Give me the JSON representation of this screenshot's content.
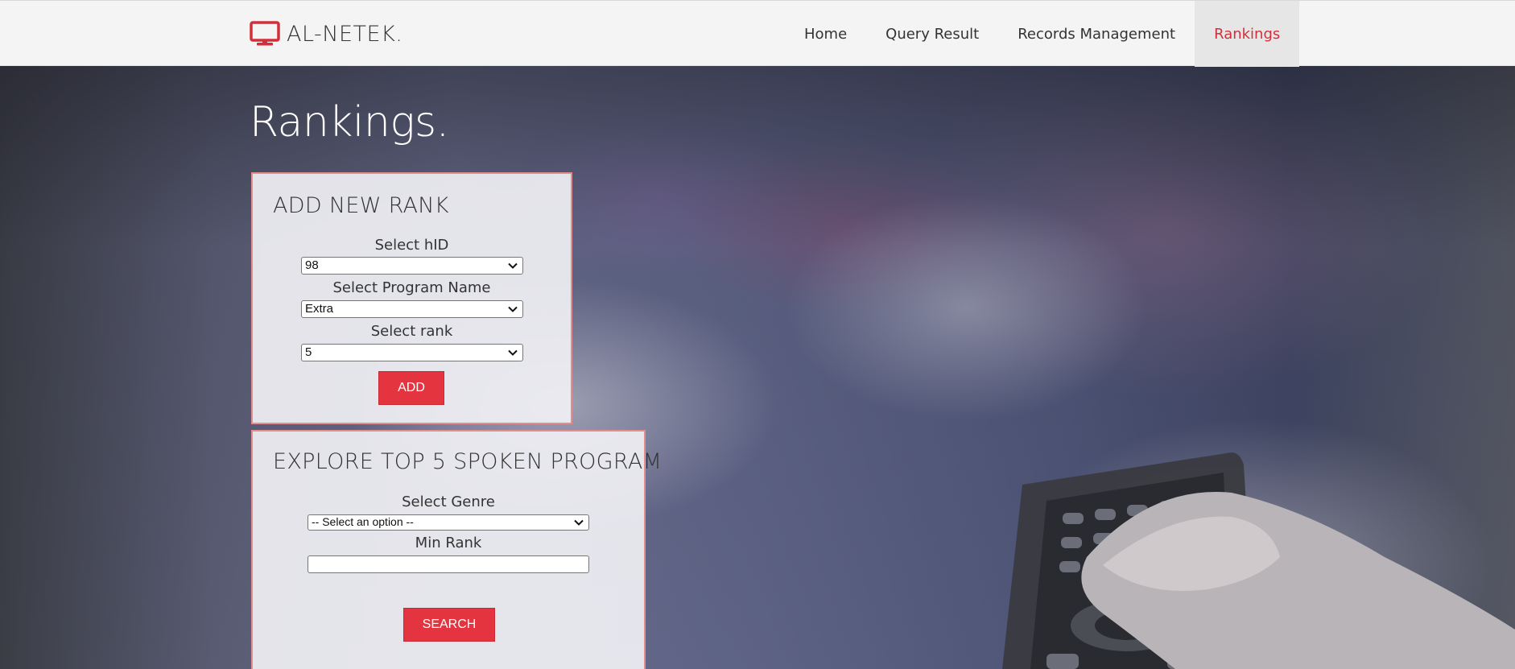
{
  "brand": {
    "name": "AL-NETEK.",
    "icon": "monitor-icon",
    "accent": "#d32f3a"
  },
  "nav": {
    "items": [
      {
        "label": "Home",
        "active": false
      },
      {
        "label": "Query Result",
        "active": false
      },
      {
        "label": "Records Management",
        "active": false
      },
      {
        "label": "Rankings",
        "active": true
      }
    ]
  },
  "page": {
    "title": "Rankings."
  },
  "add_rank": {
    "heading": "ADD NEW RANK",
    "hid": {
      "label": "Select hID",
      "value": "98"
    },
    "program": {
      "label": "Select Program Name",
      "value": "Extra"
    },
    "rank": {
      "label": "Select rank",
      "value": "5"
    },
    "button": "ADD"
  },
  "explore": {
    "heading": "EXPLORE TOP 5 SPOKEN PROGRAM",
    "genre": {
      "label": "Select Genre",
      "value": "-- Select an option --"
    },
    "min_rank": {
      "label": "Min Rank",
      "value": ""
    },
    "button": "SEARCH"
  },
  "colors": {
    "button": "#e3343f",
    "panel_border": "#e38d8d",
    "navbar": "#f4f4f4"
  }
}
